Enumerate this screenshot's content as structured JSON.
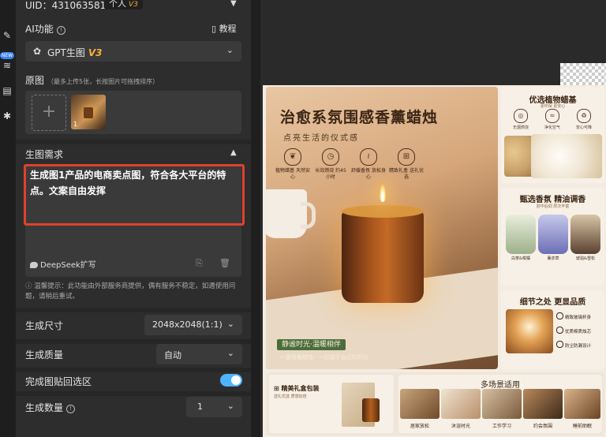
{
  "header": {
    "uid": "UID：4310635814",
    "account_type": "个人",
    "version_badge": "V3"
  },
  "rail": {
    "new_badge": "NEW"
  },
  "ai_section": {
    "label": "AI功能",
    "tutorial": "教程"
  },
  "model": {
    "name": "GPT生图",
    "version": "V3"
  },
  "original": {
    "label": "原图",
    "hint": "（最多上传5张，长按图片可拖拽排序）",
    "thumb_index": "1"
  },
  "requirements": {
    "label": "生图需求",
    "text": "生成图1产品的电商卖点图，符合各大平台的特点。文案自由发挥",
    "deepseek_label": "DeepSeek扩写",
    "warning": "温馨提示：此功能由外部服务商提供，偶有服务不稳定，如遇使用问题，请稍后重试。"
  },
  "size": {
    "label": "生成尺寸",
    "value": "2048x2048(1:1)"
  },
  "quality": {
    "label": "生成质量",
    "value": "自动"
  },
  "paste_back": {
    "label": "完成图贴回选区",
    "enabled": true
  },
  "count": {
    "label": "生成数量",
    "value": "1"
  },
  "poster": {
    "title": "治愈系氛围感香薰蜡烛",
    "subtitle": "点亮生活的仪式感",
    "features": [
      {
        "icon": "leaf-icon",
        "text": "植物蜡基 天然安心"
      },
      {
        "icon": "clock-icon",
        "text": "长效燃烧 约45小时"
      },
      {
        "icon": "steam-icon",
        "text": "舒缓香氛 放松身心"
      },
      {
        "icon": "gift-icon",
        "text": "精致礼盒 送礼优选"
      }
    ],
    "tag": "静谧时光·温暖相伴",
    "tag_sub": "一盏香薰蜡烛 · 一份属于自己的时光",
    "plant_card": {
      "title": "优选植物蜡基",
      "sub": "更环保 更安心",
      "items": [
        "无烟燃烧",
        "净化空气",
        "安心可降"
      ]
    },
    "oil_card": {
      "title": "甄选香氛 精油调香",
      "sub": "前中后调 层次丰富",
      "oils": [
        "白茶&柑橘",
        "薰衣草",
        "琥珀&雪松"
      ]
    },
    "detail_card": {
      "title": "细节之处 更显品质",
      "items": [
        "精致玻璃杯身",
        "优质棉质烛芯",
        "防尘防漏设计"
      ]
    },
    "gift": {
      "title": "精美礼盒包装",
      "sub": "送礼优选 质感加倍"
    },
    "scenes": {
      "title": "多场景适用",
      "items": [
        "居家放松",
        "沐浴时光",
        "工作学习",
        "约会氛围",
        "睡前助眠"
      ]
    }
  }
}
